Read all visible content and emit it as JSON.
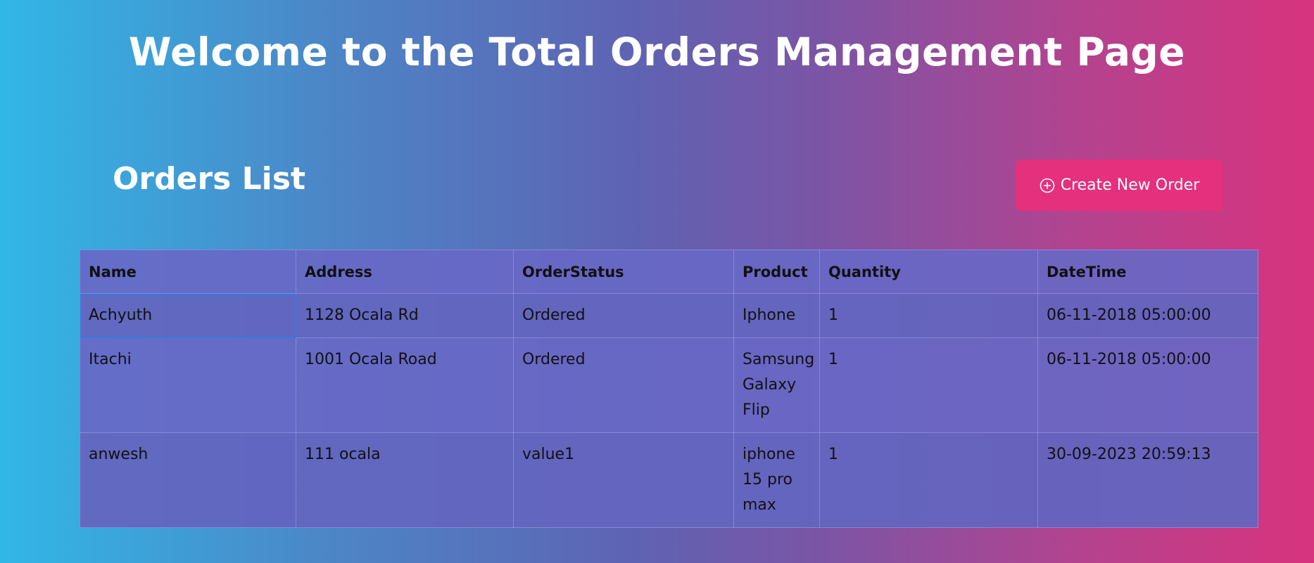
{
  "page": {
    "title": "Welcome to the Total Orders Management Page"
  },
  "orders_section": {
    "title": "Orders List",
    "create_button_label": "Create New Order",
    "create_button_icon": "plus-circle-icon"
  },
  "colors": {
    "gradient_left": "#31b7e6",
    "gradient_middle": "#5e63b3",
    "gradient_right": "#d8337d",
    "button": "#e5307d",
    "table": "#6868c6"
  },
  "table": {
    "columns": [
      "Name",
      "Address",
      "OrderStatus",
      "Product",
      "Quantity",
      "DateTime"
    ],
    "rows": [
      [
        "Achyuth",
        "1128 Ocala Rd",
        "Ordered",
        "Iphone",
        "1",
        "06-11-2018 05:00:00"
      ],
      [
        "Itachi",
        "1001 Ocala Road",
        "Ordered",
        "Samsung Galaxy Flip",
        "1",
        "06-11-2018 05:00:00"
      ],
      [
        "anwesh",
        "111 ocala",
        "value1",
        "iphone 15 pro max",
        "1",
        "30-09-2023 20:59:13"
      ]
    ]
  }
}
